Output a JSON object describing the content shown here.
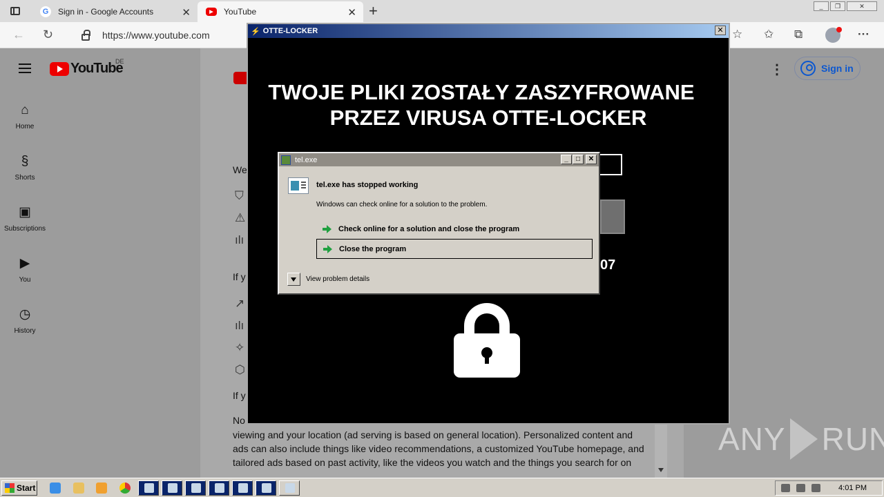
{
  "browser": {
    "tabs": [
      {
        "title": "Sign in - Google Accounts",
        "icon": "google-icon"
      },
      {
        "title": "YouTube",
        "icon": "youtube-icon",
        "active": true
      }
    ],
    "address": "https://www.youtube.com"
  },
  "youtube": {
    "logo_text": "YouTube",
    "region": "DE",
    "sidebar": [
      {
        "label": "Home",
        "icon": "home-icon"
      },
      {
        "label": "Shorts",
        "icon": "shorts-icon"
      },
      {
        "label": "Subscriptions",
        "icon": "subscriptions-icon"
      },
      {
        "label": "You",
        "icon": "you-icon"
      },
      {
        "label": "History",
        "icon": "history-icon"
      }
    ],
    "signin_label": "Sign in",
    "consent": {
      "we_fragment": "We",
      "if_fragment_1": "If y",
      "if_fragment_2": "If y",
      "no_fragment": "No",
      "paragraph": "viewing and your location (ad serving is based on general location). Personalized content and ads can also include things like video recommendations, a customized YouTube homepage, and tailored ads based on past activity, like the videos you watch and the things you search for on"
    }
  },
  "locker": {
    "title": "OTTE-LOCKER",
    "heading_line1": "TWOJE PLIKI ZOSTAŁY ZASZYFROWANE",
    "heading_line2": "PRZEZ VIRUSA OTTE-LOCKER",
    "visible_number": "07"
  },
  "dialog": {
    "title": "tel.exe",
    "heading": "tel.exe has stopped working",
    "subtext": "Windows can check online for a solution to the problem.",
    "option_check": "Check online for a solution and close the program",
    "option_close": "Close the program",
    "details": "View problem details"
  },
  "watermark": {
    "left": "ANY",
    "right": "RUN"
  },
  "taskbar": {
    "start_label": "Start",
    "clock": "4:01 PM"
  }
}
